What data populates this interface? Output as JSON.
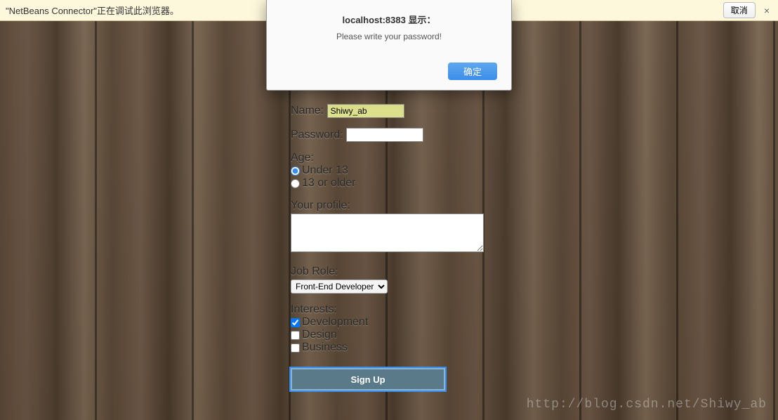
{
  "infobar": {
    "text": "\"NetBeans Connector\"正在调试此浏览器。",
    "cancel": "取消",
    "close": "×"
  },
  "dialog": {
    "title": "localhost:8383 显示：",
    "message": "Please write your password!",
    "ok": "确定"
  },
  "form": {
    "name_label": "Name:",
    "name_value": "Shiwy_ab",
    "password_label": "Password:",
    "age_label": "Age:",
    "age_options": {
      "under13": "Under 13",
      "older": "13 or older"
    },
    "profile_label": "Your profile:",
    "jobrole_label": "Job Role:",
    "jobrole_selected": "Front-End Developer",
    "interests_label": "Interests:",
    "interests": {
      "development": "Development",
      "design": "Design",
      "business": "Business"
    },
    "submit": "Sign Up"
  },
  "watermark": "http://blog.csdn.net/Shiwy_ab"
}
